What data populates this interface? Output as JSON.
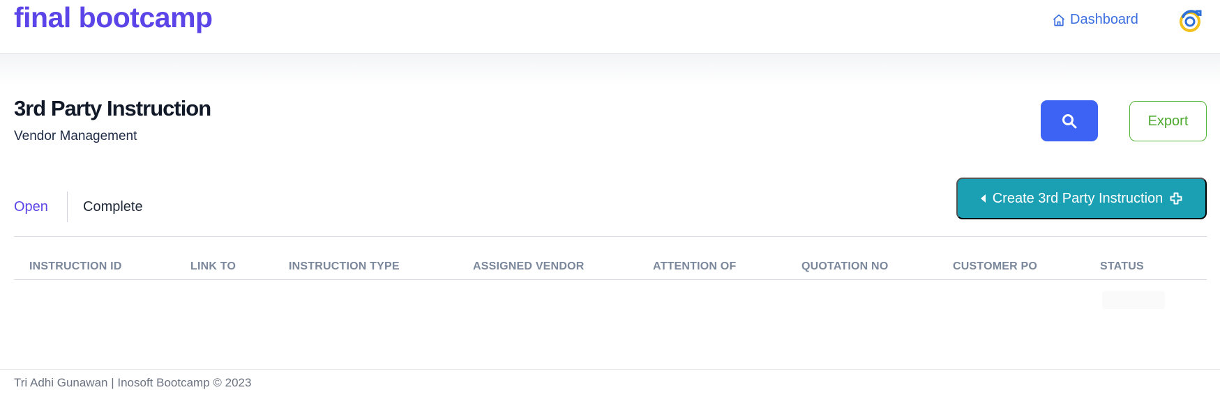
{
  "header": {
    "brand": "final bootcamp",
    "dashboard_label": "Dashboard",
    "dashboard_icon": "home-icon",
    "avatar_icon": "user-avatar-icon"
  },
  "page": {
    "title": "3rd Party Instruction",
    "subtitle": "Vendor Management"
  },
  "toolbar": {
    "search_icon": "search-icon",
    "export_label": "Export",
    "create_label": "Create 3rd Party Instruction"
  },
  "tabs": [
    {
      "label": "Open",
      "active": true
    },
    {
      "label": "Complete",
      "active": false
    }
  ],
  "table": {
    "columns": [
      "INSTRUCTION ID",
      "LINK TO",
      "INSTRUCTION TYPE",
      "ASSIGNED VENDOR",
      "ATTENTION OF",
      "QUOTATION NO",
      "CUSTOMER PO",
      "STATUS"
    ],
    "rows": []
  },
  "footer": {
    "text": "Tri Adhi Gunawan | Inosoft Bootcamp © 2023"
  },
  "colors": {
    "brand": "#5b45e8",
    "primary": "#3d63f5",
    "export": "#4ca82d",
    "create": "#1b9fb3",
    "table_header": "#7b879b"
  }
}
